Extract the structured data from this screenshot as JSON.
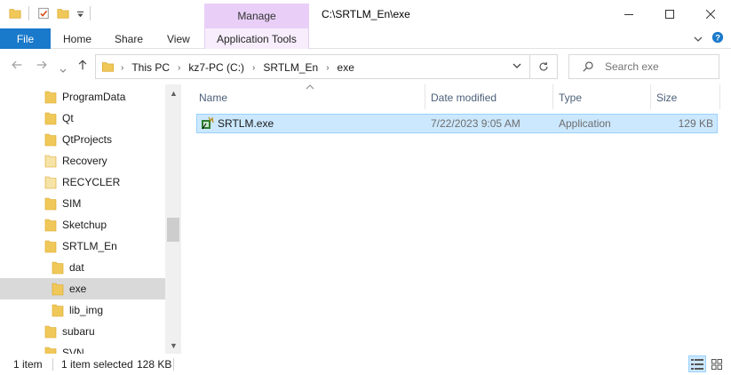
{
  "window": {
    "title": "C:\\SRTLM_En\\exe",
    "context_tab": "Manage"
  },
  "ribbon": {
    "tabs": [
      {
        "label": "File"
      },
      {
        "label": "Home"
      },
      {
        "label": "Share"
      },
      {
        "label": "View"
      },
      {
        "label": "Application Tools"
      }
    ]
  },
  "address": {
    "crumbs": [
      "This PC",
      "kz7-PC (C:)",
      "SRTLM_En",
      "exe"
    ],
    "search_placeholder": "Search exe"
  },
  "nav": {
    "items": [
      {
        "label": "ProgramData",
        "indent": 0,
        "folder_color": "#f0c85a"
      },
      {
        "label": "Qt",
        "indent": 0,
        "folder_color": "#f0c85a"
      },
      {
        "label": "QtProjects",
        "indent": 0,
        "folder_color": "#f0c85a"
      },
      {
        "label": "Recovery",
        "indent": 0,
        "folder_color": "#f6e3a8"
      },
      {
        "label": "RECYCLER",
        "indent": 0,
        "folder_color": "#f6e3a8"
      },
      {
        "label": "SIM",
        "indent": 0,
        "folder_color": "#f0c85a"
      },
      {
        "label": "Sketchup",
        "indent": 0,
        "folder_color": "#f0c85a"
      },
      {
        "label": "SRTLM_En",
        "indent": 0,
        "folder_color": "#f0c85a"
      },
      {
        "label": "dat",
        "indent": 1,
        "folder_color": "#f0c85a"
      },
      {
        "label": "exe",
        "indent": 1,
        "folder_color": "#f0c85a",
        "selected": true
      },
      {
        "label": "lib_img",
        "indent": 1,
        "folder_color": "#f0c85a"
      },
      {
        "label": "subaru",
        "indent": 0,
        "folder_color": "#f0c85a"
      },
      {
        "label": "SVN",
        "indent": 0,
        "folder_color": "#f0c85a"
      }
    ]
  },
  "filelist": {
    "columns": {
      "name": "Name",
      "date": "Date modified",
      "type": "Type",
      "size": "Size"
    },
    "rows": [
      {
        "name": "SRTLM.exe",
        "date": "7/22/2023 9:05 AM",
        "type": "Application",
        "size": "129 KB",
        "selected": true
      }
    ]
  },
  "status": {
    "item_count": "1 item",
    "selection": "1 item selected",
    "selection_size": "128 KB"
  },
  "colors": {
    "file_tab": "#1979ca",
    "manage_tab": "#e9cff7",
    "selection": "#cce8ff",
    "folder": "#f0c85a"
  }
}
